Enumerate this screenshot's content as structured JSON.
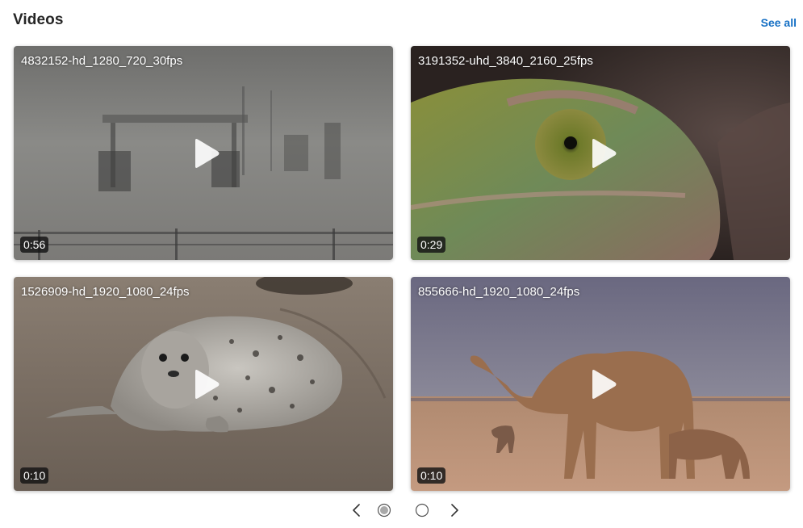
{
  "header": {
    "title": "Videos",
    "see_all_label": "See all"
  },
  "videos": [
    {
      "title": "4832152-hd_1280_720_30fps",
      "duration": "0:56"
    },
    {
      "title": "3191352-uhd_3840_2160_25fps",
      "duration": "0:29"
    },
    {
      "title": "1526909-hd_1920_1080_24fps",
      "duration": "0:10"
    },
    {
      "title": "855666-hd_1920_1080_24fps",
      "duration": "0:10"
    }
  ],
  "pagination": {
    "prev_icon": "chevron-left-icon",
    "next_icon": "chevron-right-icon",
    "current_page": 1,
    "total_pages": 2
  },
  "colors": {
    "accent": "#1670c4",
    "title_text": "#262626"
  }
}
